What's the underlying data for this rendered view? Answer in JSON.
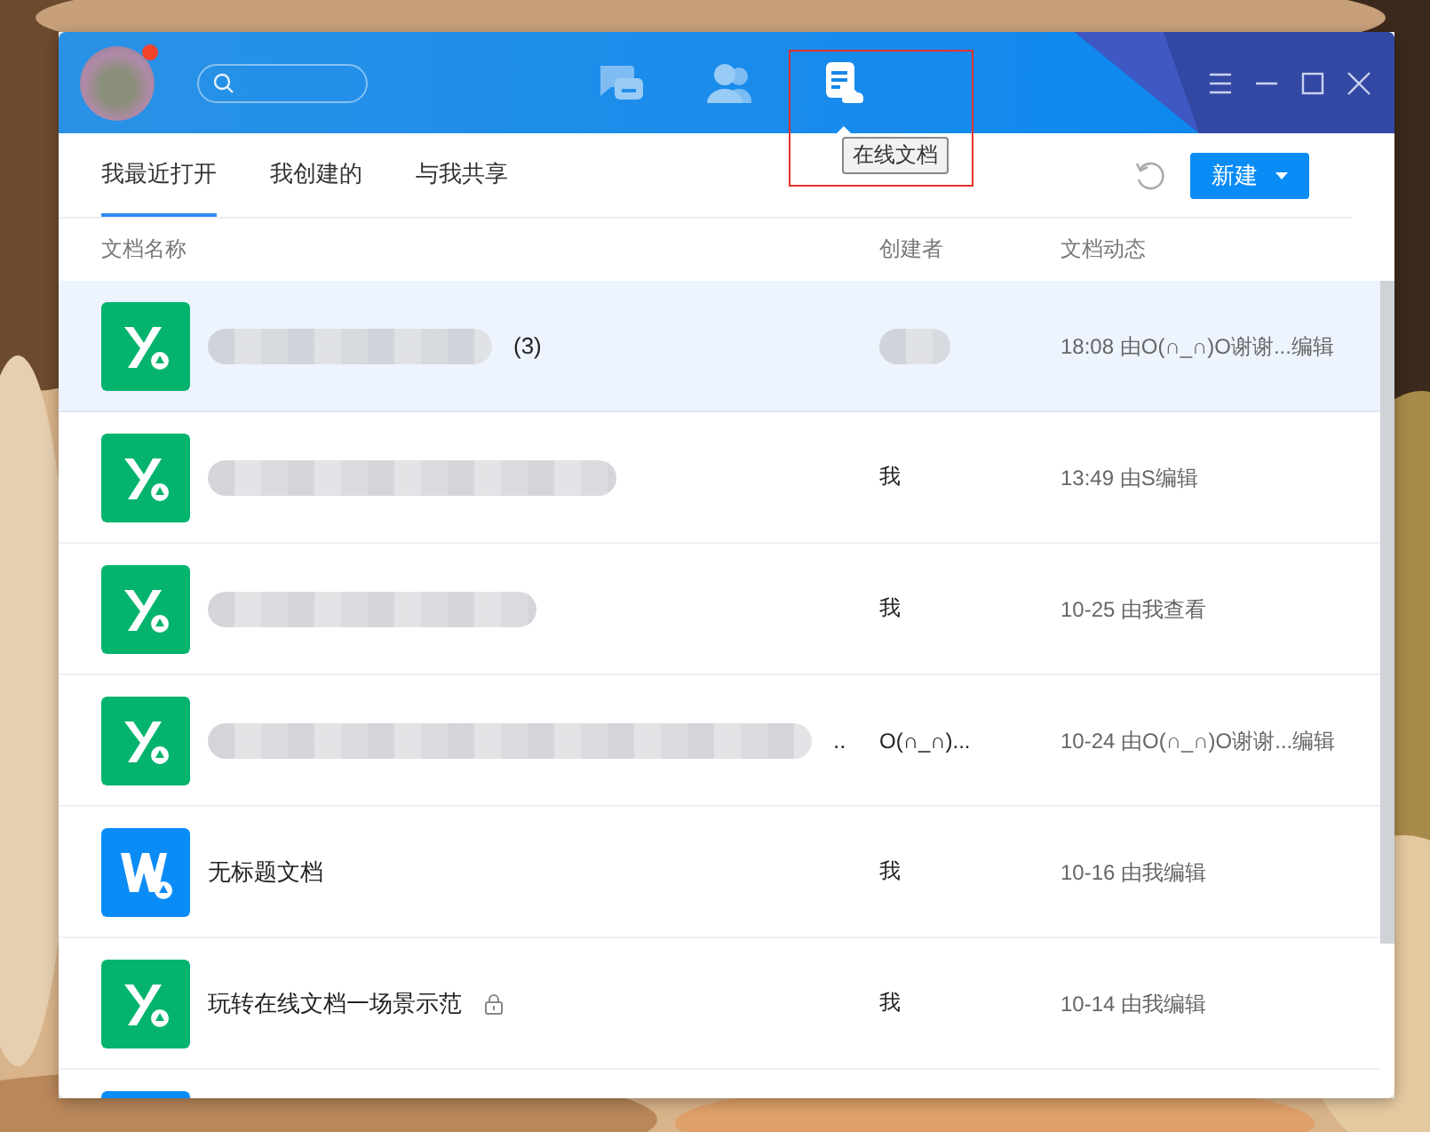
{
  "header": {
    "has_notification": true,
    "nav": [
      {
        "kind": "chat",
        "selected": false
      },
      {
        "kind": "contacts",
        "selected": false
      },
      {
        "kind": "docs",
        "selected": true
      }
    ],
    "tooltip": "在线文档"
  },
  "tabs": [
    {
      "label": "我最近打开",
      "selected": true
    },
    {
      "label": "我创建的",
      "selected": false
    },
    {
      "label": "与我共享",
      "selected": false
    }
  ],
  "new_button": "新建",
  "table": {
    "columns": [
      "文档名称",
      "创建者",
      "文档动态"
    ],
    "rows": [
      {
        "kind": "sheet",
        "name_blurred": true,
        "name": "(3)",
        "creator_blurred": true,
        "activity": "18:08 由O(∩_∩)O谢谢...编辑",
        "selected": true,
        "locked": false
      },
      {
        "kind": "sheet",
        "name_blurred": true,
        "creator": "我",
        "creator_blurred": false,
        "activity": "13:49 由S编辑",
        "selected": false,
        "locked": false
      },
      {
        "kind": "sheet",
        "name_blurred": true,
        "creator": "我",
        "creator_blurred": false,
        "activity": "10-25 由我查看",
        "selected": false,
        "locked": false
      },
      {
        "kind": "sheet",
        "name_blurred": true,
        "name": "..",
        "creator": "O(∩_∩)...",
        "creator_blurred": false,
        "activity": "10-24 由O(∩_∩)O谢谢...编辑",
        "selected": false,
        "locked": false
      },
      {
        "kind": "doc",
        "name_blurred": false,
        "name": "无标题文档",
        "creator": "我",
        "creator_blurred": false,
        "activity": "10-16 由我编辑",
        "selected": false,
        "locked": false
      },
      {
        "kind": "sheet",
        "name_blurred": false,
        "name": "玩转在线文档一场景示范",
        "creator": "我",
        "creator_blurred": false,
        "activity": "10-14 由我编辑",
        "selected": false,
        "locked": true
      },
      {
        "kind": "doc",
        "name_blurred": false,
        "creator_blurred": false,
        "selected": false,
        "locked": false
      }
    ]
  }
}
